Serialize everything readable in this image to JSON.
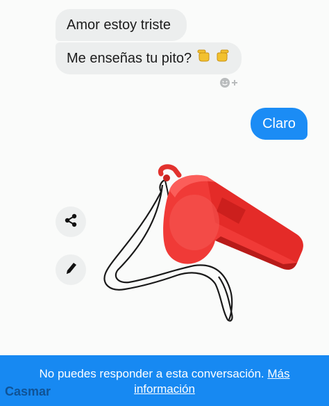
{
  "messages": {
    "received_1": "Amor estoy triste",
    "received_2": "Me enseñas tu pito?",
    "sent_1": "Claro"
  },
  "icons": {
    "emoji": "pointing-hands-emoji",
    "react": "add-reaction-icon",
    "share": "share-icon",
    "edit": "pencil-icon"
  },
  "footer": {
    "notice": "No puedes responder a esta conversación.",
    "link_part_1": "Más",
    "link_part_2": "información"
  },
  "watermark": "Casmar",
  "colors": {
    "sent_bubble": "#1b8cf5",
    "received_bubble": "#eceeee",
    "footer_bar": "#1789f2",
    "whistle": "#f03a37"
  }
}
